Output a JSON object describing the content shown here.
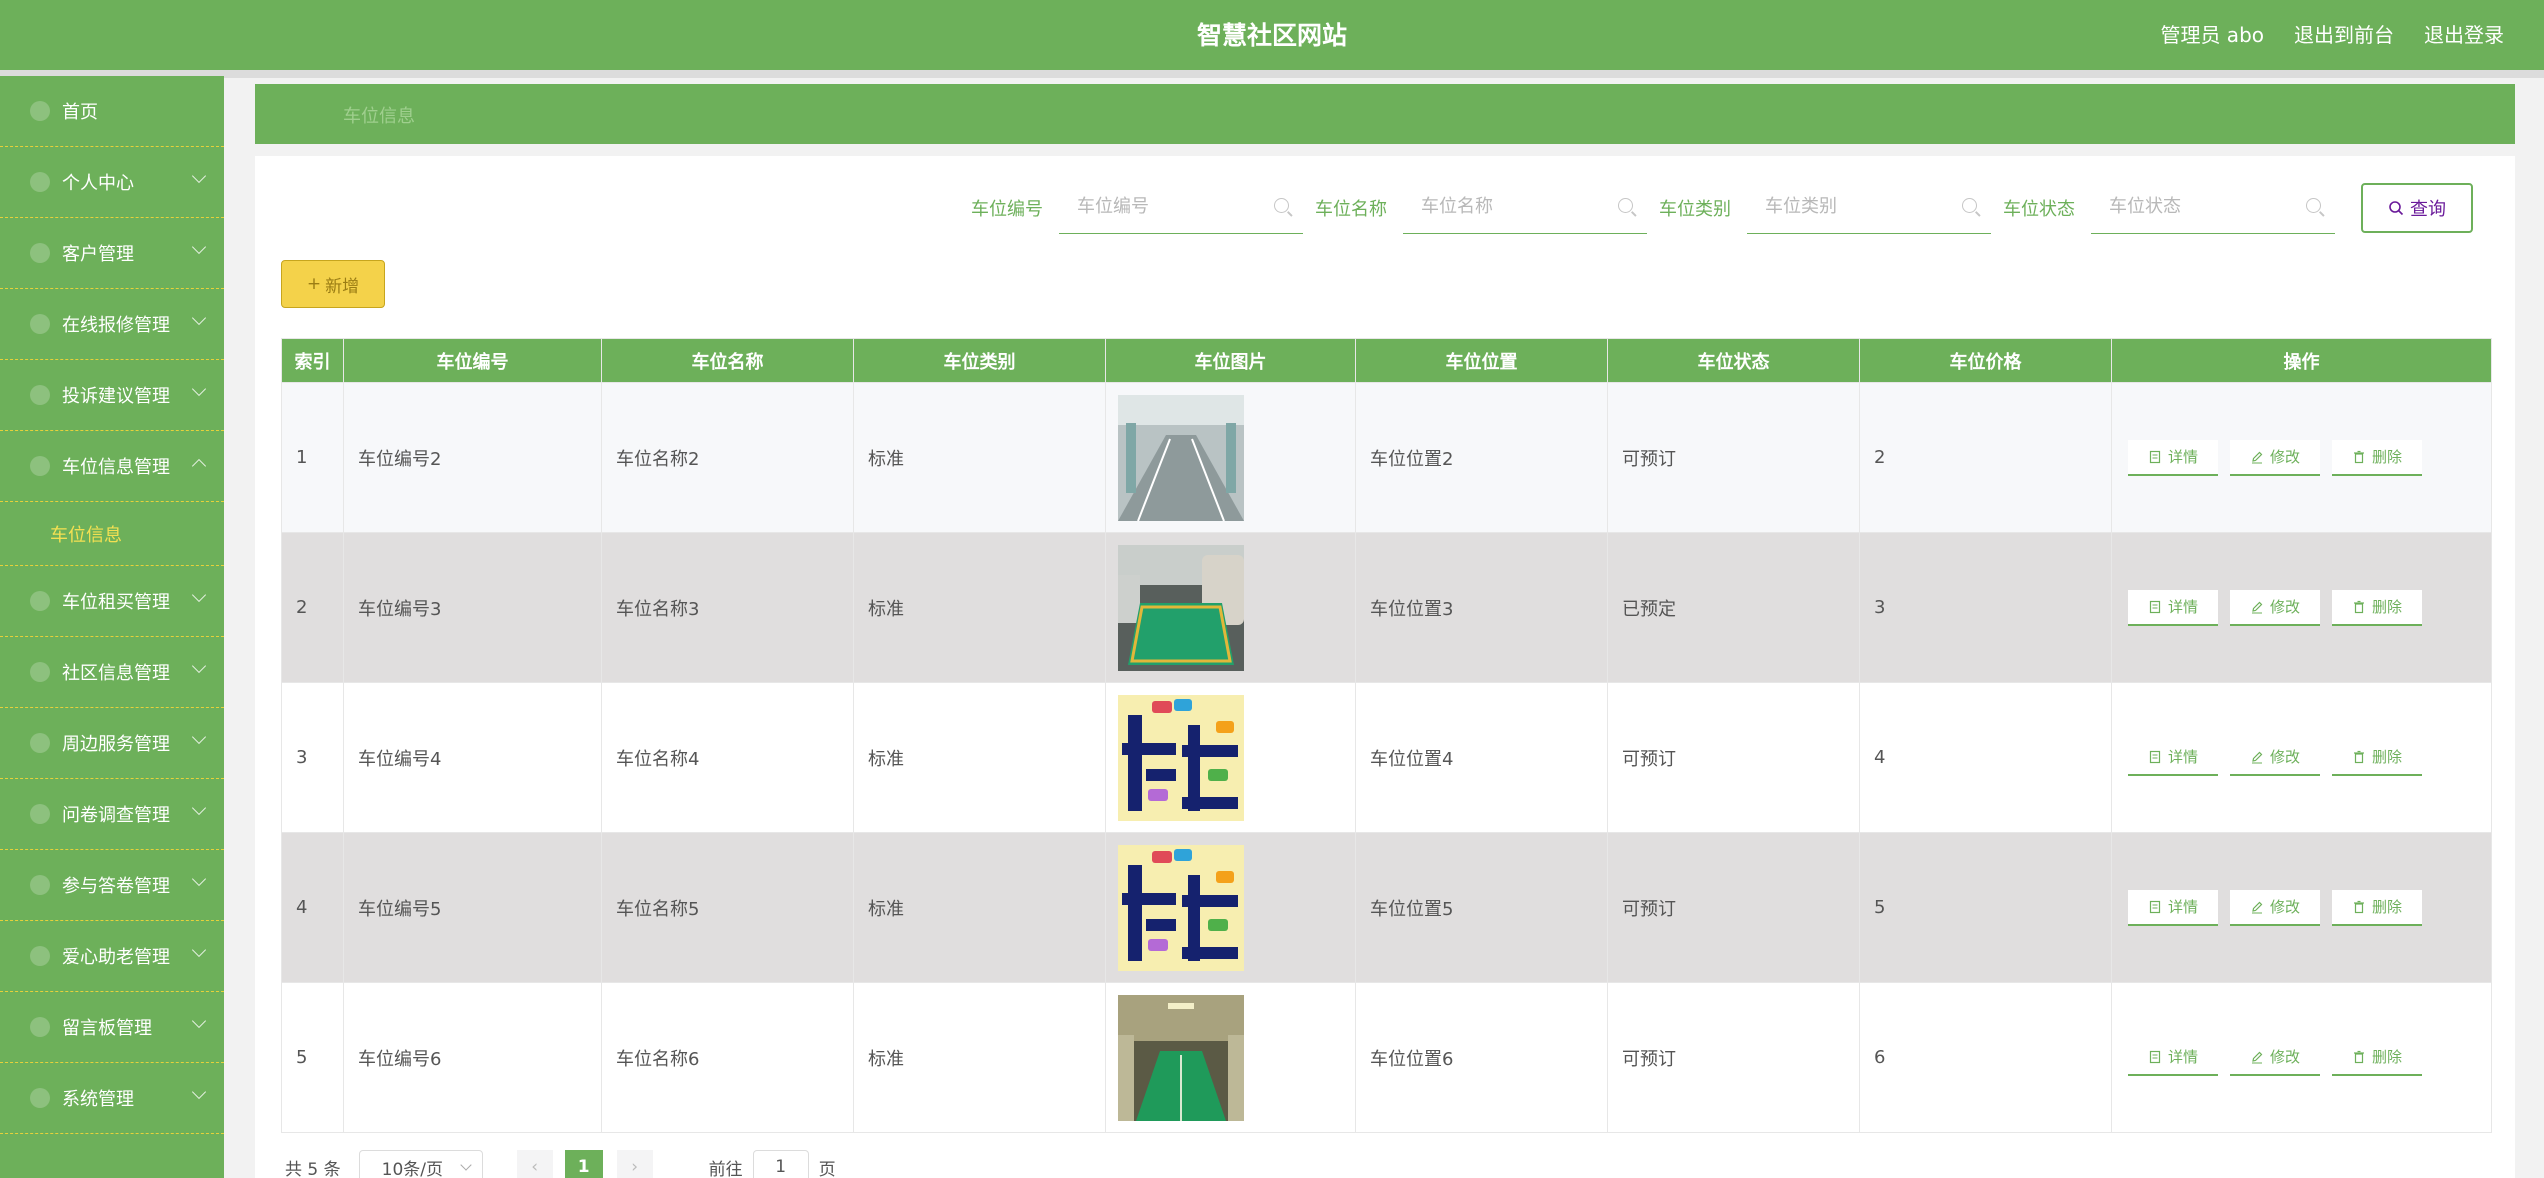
{
  "header": {
    "site_title": "智慧社区网站",
    "admin_label": "管理员 abo",
    "to_front": "退出到前台",
    "logout": "退出登录"
  },
  "sidebar": {
    "items": [
      {
        "label": "首页"
      },
      {
        "label": "个人中心"
      },
      {
        "label": "客户管理"
      },
      {
        "label": "在线报修管理"
      },
      {
        "label": "投诉建议管理"
      },
      {
        "label": "车位信息管理"
      },
      {
        "label": "车位租买管理"
      },
      {
        "label": "社区信息管理"
      },
      {
        "label": "周边服务管理"
      },
      {
        "label": "问卷调查管理"
      },
      {
        "label": "参与答卷管理"
      },
      {
        "label": "爱心助老管理"
      },
      {
        "label": "留言板管理"
      },
      {
        "label": "系统管理"
      }
    ],
    "active_sub": "车位信息"
  },
  "breadcrumb": "车位信息",
  "search": {
    "fields": [
      {
        "label": "车位编号",
        "placeholder": "车位编号"
      },
      {
        "label": "车位名称",
        "placeholder": "车位名称"
      },
      {
        "label": "车位类别",
        "placeholder": "车位类别"
      },
      {
        "label": "车位状态",
        "placeholder": "车位状态"
      }
    ],
    "query_label": "查询"
  },
  "add_label": "新增",
  "table": {
    "columns": [
      "索引",
      "车位编号",
      "车位名称",
      "车位类别",
      "车位图片",
      "车位位置",
      "车位状态",
      "车位价格",
      "操作"
    ],
    "rows": [
      {
        "idx": "1",
        "code": "车位编号2",
        "name": "车位名称2",
        "type": "标准",
        "img": "garage-aisle",
        "loc": "车位位置2",
        "status": "可预订",
        "price": "2"
      },
      {
        "idx": "2",
        "code": "车位编号3",
        "name": "车位名称3",
        "type": "标准",
        "img": "parking-spot-car",
        "loc": "车位位置3",
        "status": "已预定",
        "price": "3"
      },
      {
        "idx": "3",
        "code": "车位编号4",
        "name": "车位名称4",
        "type": "标准",
        "img": "cartoon-sign",
        "loc": "车位位置4",
        "status": "可预订",
        "price": "4"
      },
      {
        "idx": "4",
        "code": "车位编号5",
        "name": "车位名称5",
        "type": "标准",
        "img": "cartoon-sign",
        "loc": "车位位置5",
        "status": "可预订",
        "price": "5"
      },
      {
        "idx": "5",
        "code": "车位编号6",
        "name": "车位名称6",
        "type": "标准",
        "img": "green-spot",
        "loc": "车位位置6",
        "status": "可预订",
        "price": "6"
      }
    ],
    "actions": {
      "detail": "详情",
      "edit": "修改",
      "delete": "删除"
    }
  },
  "pagination": {
    "total": "共 5 条",
    "page_size": "10条/页",
    "current": "1",
    "goto_prefix": "前往",
    "goto_value": "1",
    "goto_suffix": "页"
  },
  "colors": {
    "primary": "#6db05a",
    "highlight": "#f3e052",
    "add_button": "#f4d24a"
  }
}
